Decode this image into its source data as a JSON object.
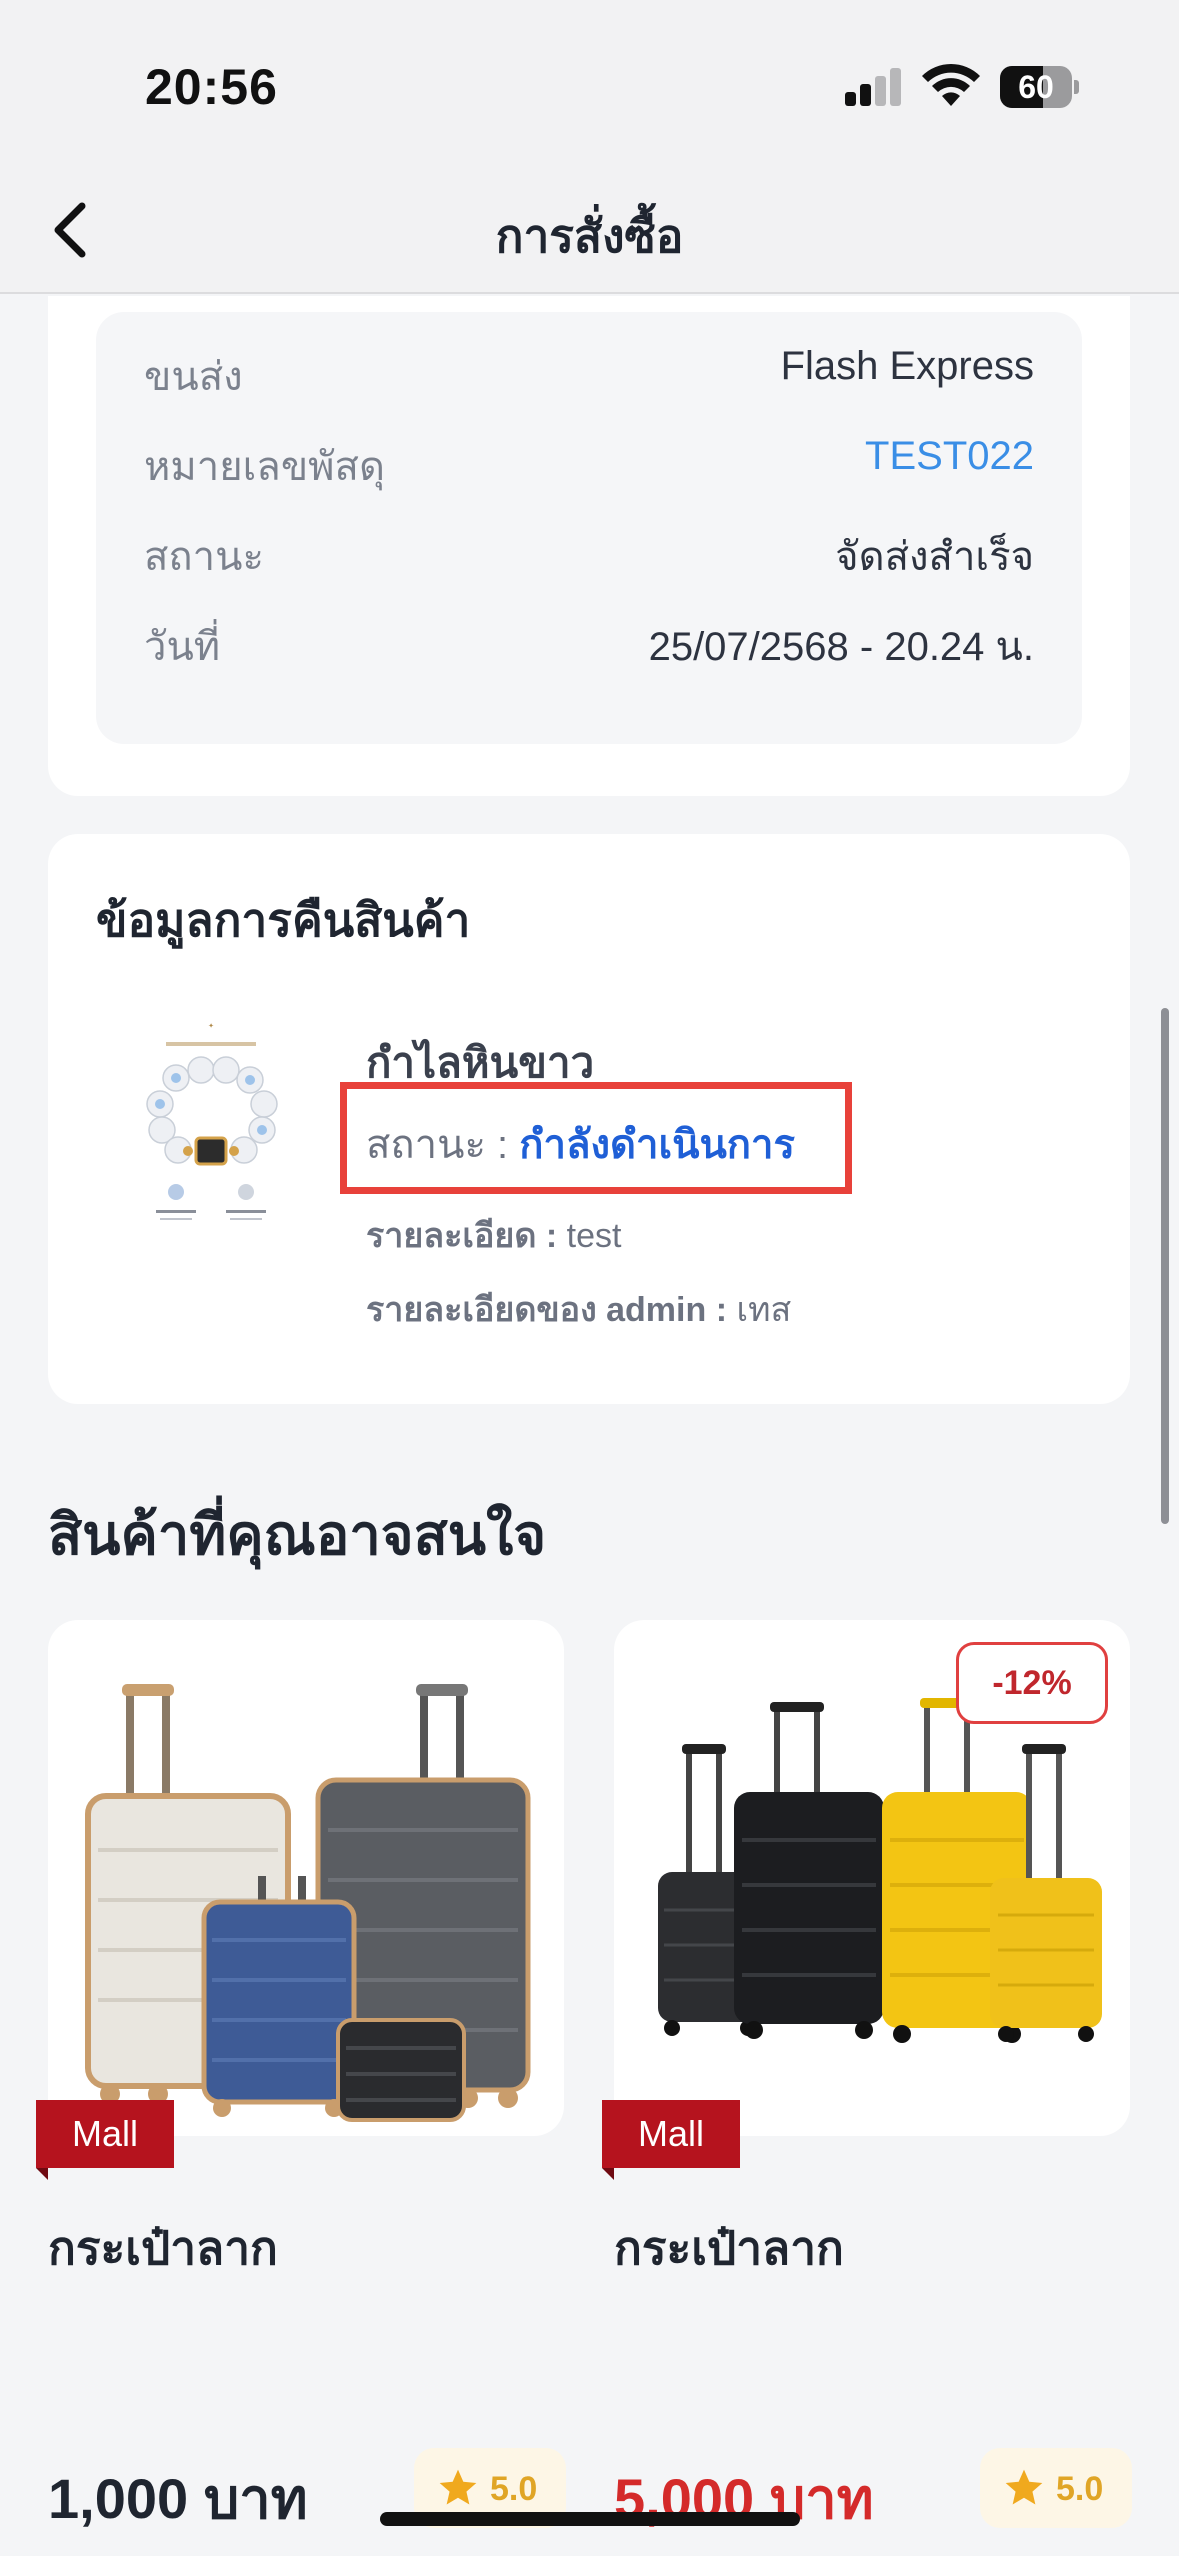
{
  "status_bar": {
    "time": "20:56",
    "battery": "60",
    "battery_level": 0.6
  },
  "nav": {
    "title": "การสั่งซื้อ"
  },
  "shipping": {
    "rows": [
      {
        "key": "ขนส่ง",
        "value": "Flash Express"
      },
      {
        "key": "หมายเลขพัสดุ",
        "value": "TEST022"
      },
      {
        "key": "สถานะ",
        "value": "จัดส่งสำเร็จ"
      },
      {
        "key": "วันที่",
        "value": "25/07/2568 - 20.24 น."
      }
    ]
  },
  "return_info": {
    "title": "ข้อมูลการคืนสินค้า",
    "product_name": "กำไลหินขาว",
    "status_label": "สถานะ :",
    "status_value": "กำลังดำเนินการ",
    "detail_label": "รายละเอียด :",
    "detail_value": "test",
    "admin_detail_label": "รายละเอียดของ admin :",
    "admin_detail_value": "เทส"
  },
  "recommendations": {
    "title": "สินค้าที่คุณอาจสนใจ",
    "items": [
      {
        "badge": "Mall",
        "name": "กระเป๋าลาก",
        "price": "1,000 บาท",
        "rating": "5.0",
        "discount": ""
      },
      {
        "badge": "Mall",
        "name": "กระเป๋าลาก",
        "price": "5,000 บาท",
        "rating": "5.0",
        "discount": "-12%"
      }
    ]
  },
  "colors": {
    "accent_link": "#3a8ee6",
    "status_blue": "#1f5fd6",
    "highlight_red": "#e8413a",
    "mall_red": "#b5131e",
    "sale_red": "#d42a2a",
    "rating_gold": "#e0a526"
  }
}
